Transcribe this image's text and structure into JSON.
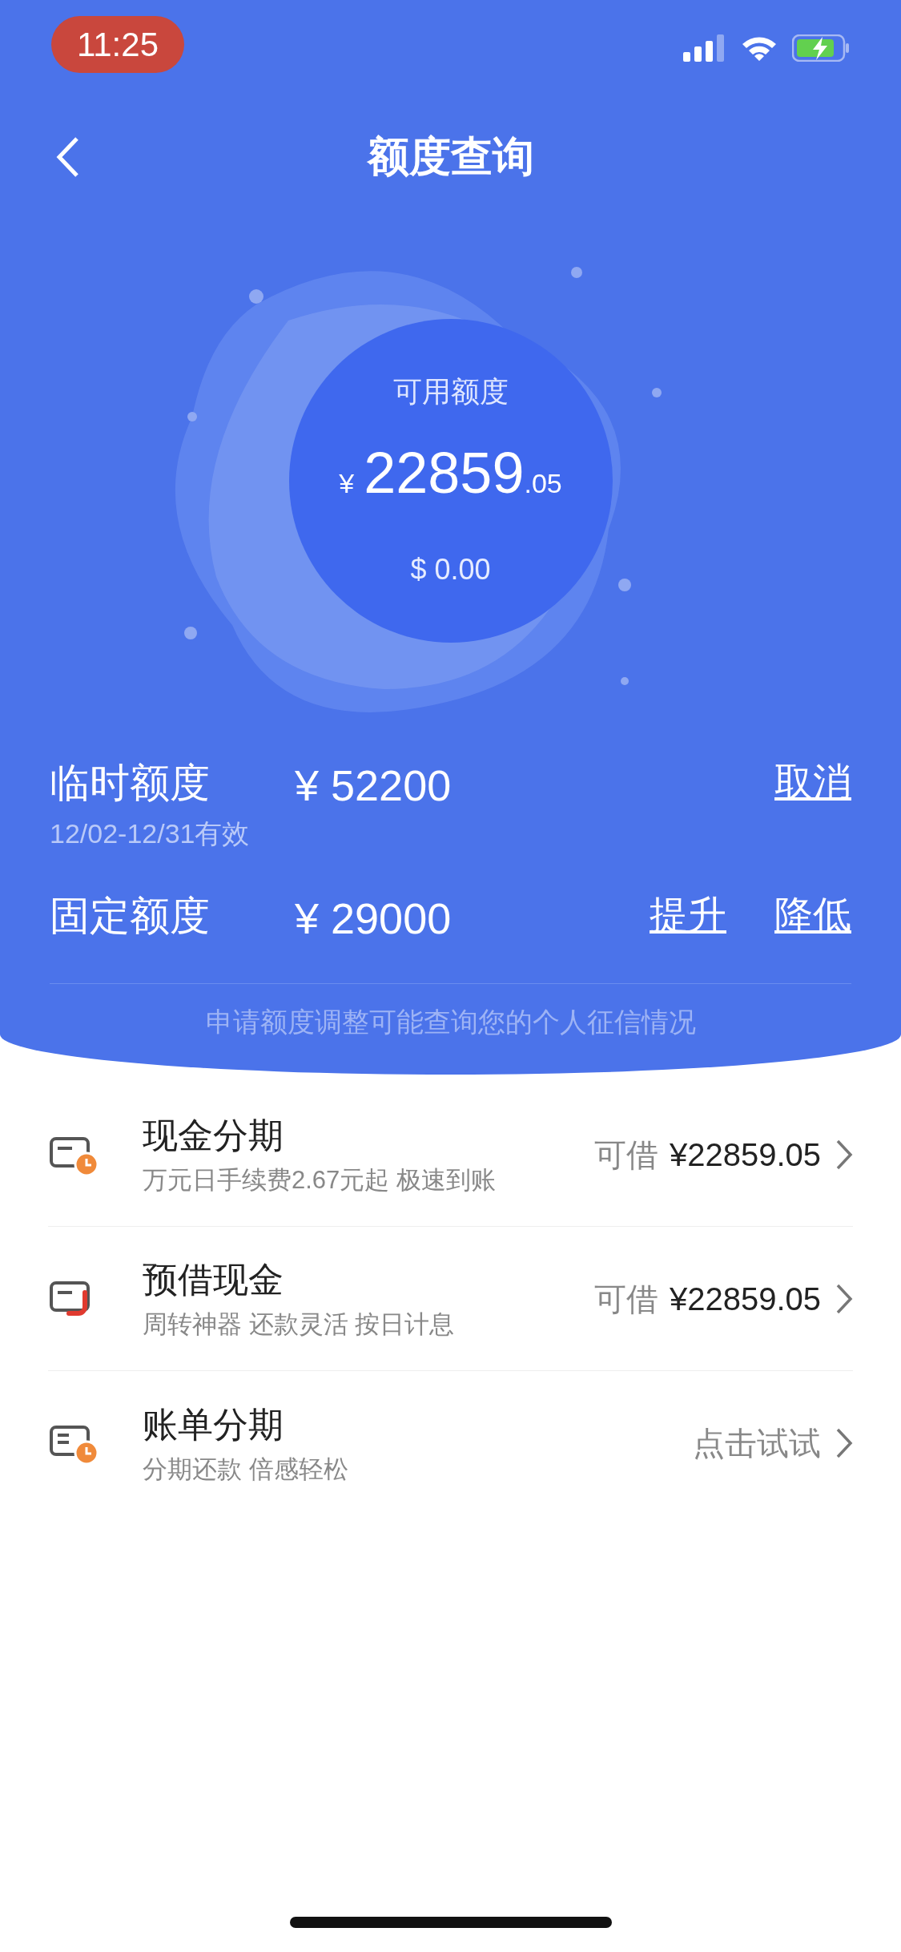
{
  "status_bar": {
    "time": "11:25"
  },
  "header": {
    "title": "额度查询"
  },
  "available": {
    "label": "可用额度",
    "currency": "¥",
    "integer": "22859",
    "decimal": ".05",
    "secondary": "$ 0.00"
  },
  "quotas": [
    {
      "label": "临时额度",
      "amount": "¥ 52200",
      "note": "12/02-12/31有效",
      "actions": [
        "取消"
      ]
    },
    {
      "label": "固定额度",
      "amount": "¥ 29000",
      "actions": [
        "提升",
        "降低"
      ]
    }
  ],
  "notice": "申请额度调整可能查询您的个人征信情况",
  "products": [
    {
      "kind": "clock",
      "title": "现金分期",
      "subtitle": "万元日手续费2.67元起 极速到账",
      "prefix": "可借",
      "value": "¥22859.05"
    },
    {
      "kind": "hook",
      "title": "预借现金",
      "subtitle": "周转神器 还款灵活 按日计息",
      "prefix": "可借",
      "value": "¥22859.05"
    },
    {
      "kind": "list",
      "title": "账单分期",
      "subtitle": "分期还款 倍感轻松",
      "value": "点击试试"
    }
  ]
}
